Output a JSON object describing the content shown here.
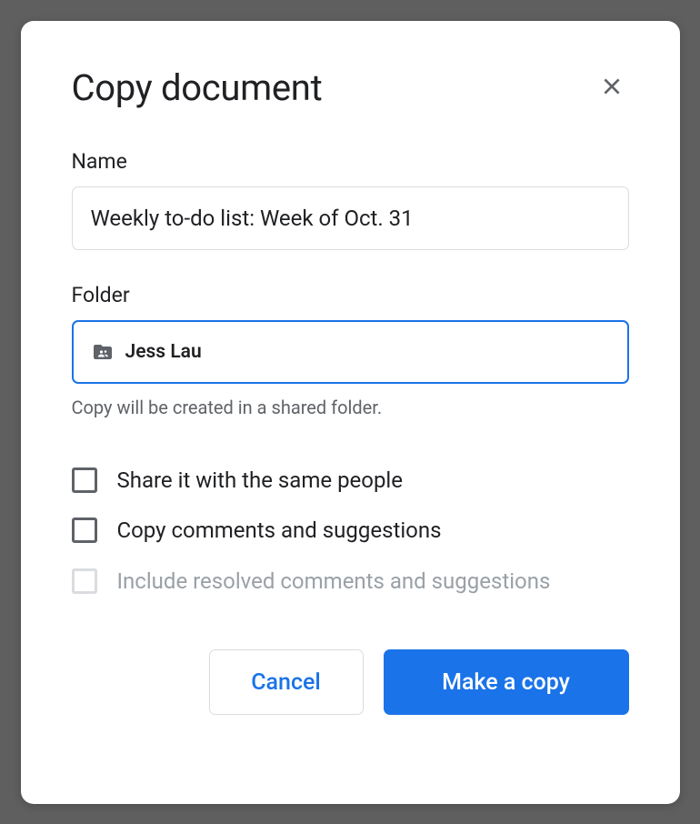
{
  "dialog": {
    "title": "Copy document",
    "name_label": "Name",
    "name_value": "Weekly to-do list: Week of Oct. 31",
    "folder_label": "Folder",
    "folder_value": "Jess Lau",
    "folder_helper": "Copy will be created in a shared folder.",
    "checkboxes": {
      "share_same": "Share it with the same people",
      "copy_comments": "Copy comments and suggestions",
      "include_resolved": "Include resolved comments and suggestions"
    },
    "buttons": {
      "cancel": "Cancel",
      "confirm": "Make a copy"
    }
  }
}
